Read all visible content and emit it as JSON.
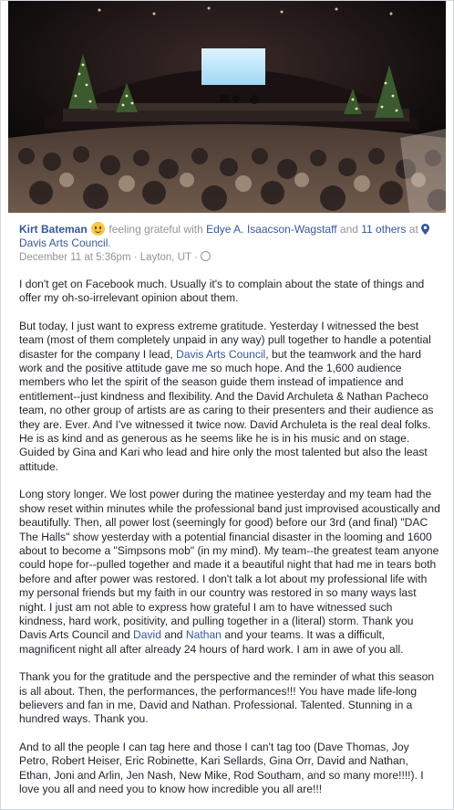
{
  "post": {
    "author": "Kirt Bateman",
    "feeling_text": "feeling grateful with",
    "tagged_person": "Edye A. Isaacson-Wagstaff",
    "and_text": "and",
    "others_link": "11 others",
    "at_text": "at",
    "place": "Davis Arts Council",
    "period": ".",
    "timestamp": "December 11 at 5:36pm",
    "separator": "·",
    "location": "Layton, UT",
    "p1": "I don't get on Facebook much. Usually it's to complain about the state of things and offer my oh-so-irrelevant opinion about them.",
    "p2_a": "But today, I just want to express extreme gratitude. Yesterday I witnessed the best team (most of them completely unpaid in any way) pull together to handle a potential disaster for the company I lead,",
    "p2_link": "Davis Arts Council",
    "p2_b": ", but the teamwork and the hard work and the positive attitude gave me so much hope. And the 1,600 audience members who let the spirit of the season guide them instead of impatience and entitlement--just kindness and flexibility. And the David Archuleta & Nathan Pacheco team, no other group of artists are as caring to their presenters and their audience as they are. Ever. And I've witnessed it twice now. David Archuleta is the real deal folks. He is as kind and as generous as he seems like he is in his music and on stage. Guided by Gina and Kari who lead and hire only the most talented but also the least attitude.",
    "p3_a": "Long story longer. We lost power during the matinee yesterday and my team had the show reset within minutes while the professional band just improvised acoustically and beautifully. Then, all power lost (seemingly for good) before our 3rd (and final) \"DAC The Halls\" show yesterday with a potential financial disaster in the looming and 1600 about to become a \"Simpsons mob\" (in my mind). My team--the greatest team anyone could hope for--pulled together and made it a beautiful night that had me in tears both before and after power was restored. I don't talk a lot about my professional life with my personal friends but my faith in our country was restored in so many ways last night. I just am not able to express how grateful I am to have witnessed such kindness, hard work, positivity, and pulling together in a (literal) storm. Thank you Davis Arts Council and",
    "p3_link1": "David",
    "p3_and": "and",
    "p3_link2": "Nathan",
    "p3_b": "and your teams. It was a difficult, magnificent night all after already 24 hours of hard work. I am in awe of you all.",
    "p4": "Thank you for the gratitude and the perspective and the reminder of what this season is all about. Then, the performances, the performances!!! You have made life-long believers and fan in me, David and Nathan. Professional. Talented. Stunning in a hundred ways. Thank you.",
    "p5": "And to all the people I can tag here and those I can't tag too (Dave Thomas, Joy Petro, Robert Heiser, Eric Robinette, Kari Sellards, Gina Orr, David and Nathan, Ethan, Joni and Arlin, Jen Nash, New Mike, Rod Southam, and so many more!!!!). I love you all and need you to know how incredible you all are!!!"
  },
  "colors": {
    "link": "#365899",
    "meta": "#90949c",
    "text": "#1d2129"
  }
}
